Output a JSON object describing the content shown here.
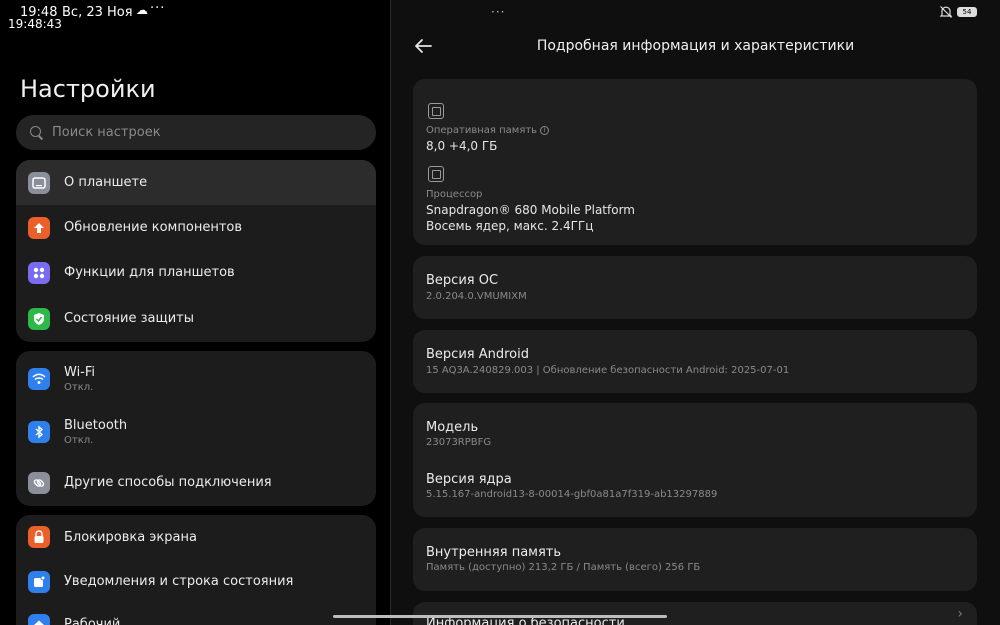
{
  "status": {
    "time": "19:48",
    "date": "Вс, 23 Ноя",
    "seconds": "19:48:43",
    "dots": "···",
    "battery": "54"
  },
  "settings": {
    "title": "Настройки",
    "search_placeholder": "Поиск настроек"
  },
  "groups": [
    {
      "items": [
        {
          "label": "О планшете",
          "icon": "tablet-icon",
          "color": "#8a8f9a"
        },
        {
          "label": "Обновление компонентов",
          "icon": "upload-arrow-icon",
          "color": "#e9602a"
        },
        {
          "label": "Функции для планшетов",
          "icon": "grid-icon",
          "color": "#7a6cf0"
        },
        {
          "label": "Состояние защиты",
          "icon": "shield-check-icon",
          "color": "#2fb84a"
        }
      ]
    },
    {
      "items": [
        {
          "label": "Wi-Fi",
          "sub": "Откл.",
          "icon": "wifi-icon",
          "color": "#2f80ed"
        },
        {
          "label": "Bluetooth",
          "sub": "Откл.",
          "icon": "bluetooth-icon",
          "color": "#2f80ed"
        },
        {
          "label": "Другие способы подключения",
          "icon": "link-icon",
          "color": "#8a8f9a"
        }
      ]
    },
    {
      "items": [
        {
          "label": "Блокировка экрана",
          "icon": "lock-icon",
          "color": "#e9602a"
        },
        {
          "label": "Уведомления и строка состояния",
          "icon": "notification-icon",
          "color": "#2f80ed"
        },
        {
          "label": "Рабочий",
          "icon": "home-icon",
          "color": "#2f80ed"
        }
      ]
    }
  ],
  "detail": {
    "title": "Подробная информация и характеристики",
    "ram_label": "Оперативная память",
    "ram_value": "8,0 +4,0 ГБ",
    "cpu_label": "Процессор",
    "cpu_value": "Snapdragon® 680 Mobile Platform",
    "cpu_detail": "Восемь ядер, макс. 2.4ГГц",
    "os_label": "Версия ОС",
    "os_value": "2.0.204.0.VMUMIXM",
    "android_label": "Версия Android",
    "android_value": "15 AQ3A.240829.003 | Обновление безопасности Android: 2025-07-01",
    "model_label": "Модель",
    "model_value": "23073RPBFG",
    "kernel_label": "Версия ядра",
    "kernel_value": "5.15.167-android13-8-00014-gbf0a81a7f319-ab13297889",
    "storage_label": "Внутренняя память",
    "storage_value": "Память (доступно)  213,2 ГБ / Память (всего)  256 ГБ",
    "security_label": "Информация о безопасности",
    "chevron": "›"
  }
}
